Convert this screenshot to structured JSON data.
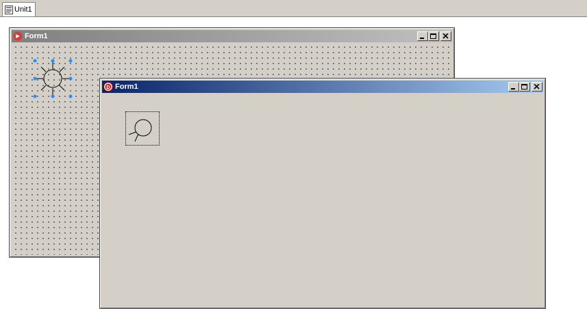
{
  "tabs": [
    {
      "label": "Unit1",
      "icon": "unit-file-icon"
    }
  ],
  "designer_form": {
    "title": "Form1",
    "icon": "lazarus-icon",
    "controls": [
      "minimize-icon",
      "maximize-icon",
      "close-icon"
    ],
    "grid": "dotted"
  },
  "runtime_form": {
    "title": "Form1",
    "icon": "delphi-icon",
    "controls": [
      "minimize-icon",
      "maximize-icon",
      "close-icon"
    ]
  },
  "colors": {
    "face": "#d4d0c8",
    "active_title_start": "#0a246a",
    "active_title_end": "#a6caf0",
    "inactive_title_start": "#808080",
    "inactive_title_end": "#c0c0c0",
    "selection_handle": "#1e90ff"
  }
}
